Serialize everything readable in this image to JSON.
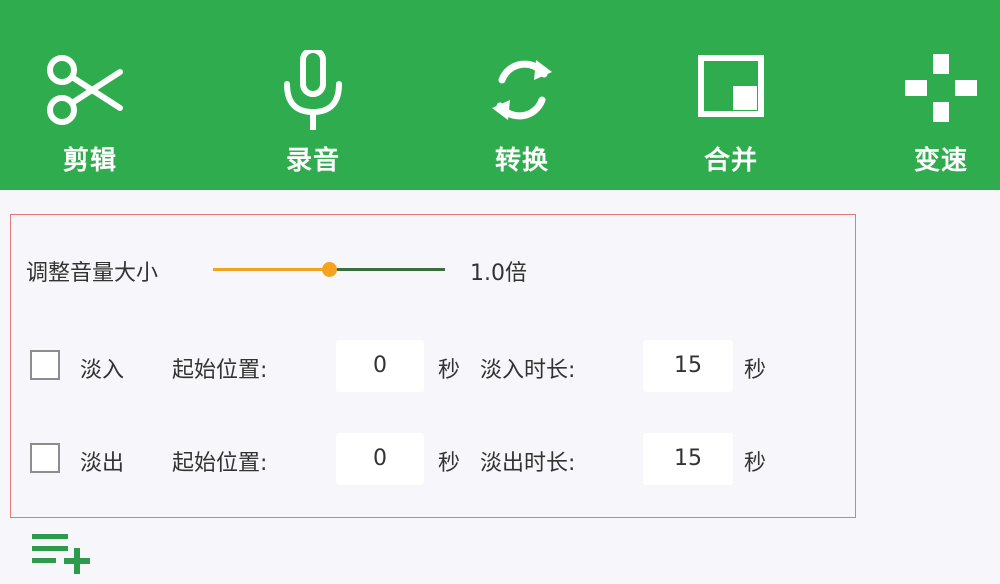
{
  "toolbar": {
    "items": [
      {
        "id": "cut",
        "label": "剪辑",
        "icon": "scissors-icon"
      },
      {
        "id": "record",
        "label": "录音",
        "icon": "microphone-icon"
      },
      {
        "id": "convert",
        "label": "转换",
        "icon": "refresh-icon"
      },
      {
        "id": "merge",
        "label": "合并",
        "icon": "merge-window-icon"
      },
      {
        "id": "speed",
        "label": "变速",
        "icon": "gamepad-icon"
      }
    ],
    "background_color": "#2fad4e"
  },
  "volume_panel": {
    "volume_label": "调整音量大小",
    "volume_value_text": "1.0倍",
    "volume_slider_position": 0.5,
    "fade_in": {
      "checked": false,
      "label": "淡入",
      "start_label": "起始位置:",
      "start_value": "0",
      "start_unit": "秒",
      "duration_label": "淡入时长:",
      "duration_value": "15",
      "duration_unit": "秒"
    },
    "fade_out": {
      "checked": false,
      "label": "淡出",
      "start_label": "起始位置:",
      "start_value": "0",
      "start_unit": "秒",
      "duration_label": "淡出时长:",
      "duration_value": "15",
      "duration_unit": "秒"
    },
    "border_color": "#e4787c",
    "slider_active_color": "#f4a320"
  },
  "footer": {
    "add_list_icon": "add-list-icon"
  }
}
